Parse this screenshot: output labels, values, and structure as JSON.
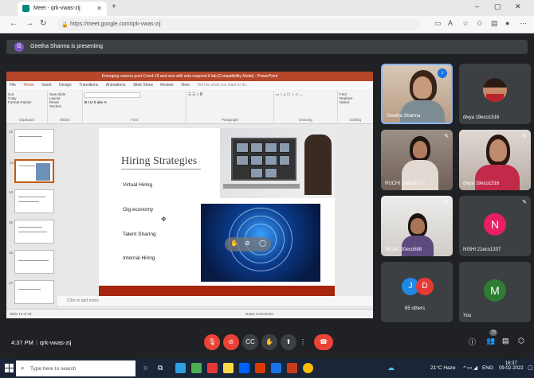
{
  "browser": {
    "tab_title": "Meet - qrk-vwas-zij",
    "new_tab": "+",
    "url": "https://meet.google.com/qrk-vwas-zij",
    "window_controls": [
      "–",
      "▢",
      "✕"
    ]
  },
  "meet": {
    "presenting_banner": "Geetha Sharma is presenting",
    "presenter_initial": "G",
    "meeting_code": "qrk-vwas-zij",
    "time": "4:37 PM",
    "people_count": "73"
  },
  "powerpoint": {
    "title_bar": "Emerging careers post Covid-19 and new skill sets required if lab [Compatibility Mode] - PowerPoint",
    "ribbon_tabs": [
      "File",
      "Home",
      "Insert",
      "Design",
      "Transitions",
      "Animations",
      "Slide Show",
      "Review",
      "View",
      "Tell me what you want to do..."
    ],
    "ribbon_groups": [
      "Clipboard",
      "Slides",
      "Font",
      "Paragraph",
      "Drawing",
      "Editing"
    ],
    "clipboard_items": [
      "Cut",
      "Copy",
      "Format Painter"
    ],
    "slides_items": [
      "New Slide",
      "Layout",
      "Reset",
      "Section"
    ],
    "editing_items": [
      "Find",
      "Replace",
      "Select"
    ],
    "slide_numbers": [
      "12",
      "13",
      "14",
      "15",
      "16",
      "17"
    ],
    "notes_placeholder": "Click to add notes",
    "status_left": "Slide 13 of 33",
    "status_right": "Notes   Comments",
    "slide": {
      "title": "Hiring Strategies",
      "bullets": [
        "Virtual Hiring",
        "Gig economy",
        "Talent Sharing",
        "Internal Hiring"
      ]
    }
  },
  "participants": [
    {
      "name": "Geetha Sharma",
      "type": "video",
      "speaking": true
    },
    {
      "name": "divya 19eco1516",
      "type": "video"
    },
    {
      "name": "RUCHI 21eco1377",
      "type": "video"
    },
    {
      "name": "divya 19eco1516",
      "type": "video"
    },
    {
      "name": "SEJAL 20eco588",
      "type": "video"
    },
    {
      "name": "NISHI 21eco1337",
      "type": "avatar",
      "initial": "N",
      "color": "#e91e63"
    },
    {
      "name": "65 others",
      "type": "group",
      "initials": [
        "J",
        "D"
      ],
      "colors": [
        "#1e88e5",
        "#e53935"
      ]
    },
    {
      "name": "You",
      "type": "avatar",
      "initial": "M",
      "color": "#2e7d32"
    }
  ],
  "taskbar": {
    "search_placeholder": "Type here to search",
    "weather": "21°C  Haze",
    "language": "ENG",
    "clock_time": "16:37",
    "clock_date": "09-02-2022"
  },
  "colors": {
    "meet_bg": "#202124",
    "hangup": "#ea4335",
    "powerpoint_brand": "#b7472a"
  }
}
